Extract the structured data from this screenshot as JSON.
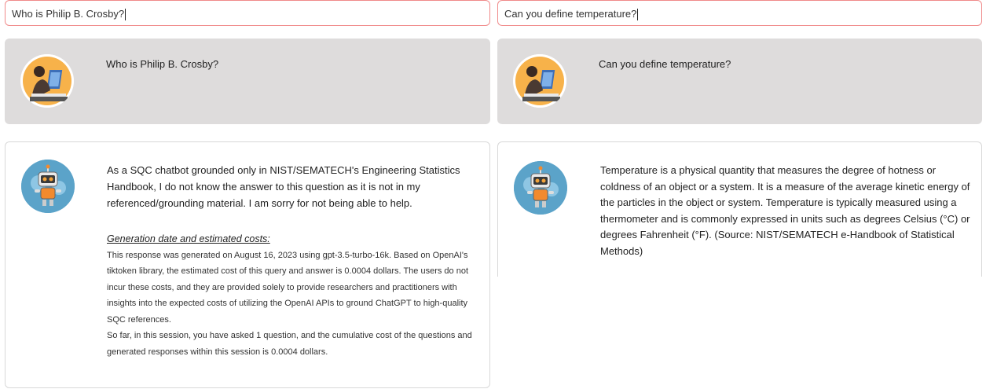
{
  "left": {
    "input_value": "Who is Philip B. Crosby?",
    "user_message": "Who is Philip B. Crosby?",
    "bot_answer": "As a SQC chatbot grounded only in NIST/SEMATECH's Engineering Statistics Handbook, I do not know the answer to this question as it is not in my referenced/grounding material. I am sorry for not being able to help.",
    "generation_title": "Generation date and estimated costs:",
    "generation_text": "This response was generated on August 16, 2023 using gpt-3.5-turbo-16k. Based on OpenAI's tiktoken library, the estimated cost of this query and answer is 0.0004 dollars. The users do not incur these costs, and they are provided solely to provide researchers and practitioners with insights into the expected costs of utilizing the OpenAI APIs to ground ChatGPT to high-quality SQC references.",
    "session_text": "So far, in this session, you have asked 1 question, and the cumulative cost of the questions and generated responses within this session is 0.0004 dollars."
  },
  "right": {
    "input_value": "Can you define temperature?",
    "user_message": "Can you define temperature?",
    "bot_answer": "Temperature is a physical quantity that measures the degree of hotness or coldness of an object or a system. It is a measure of the average kinetic energy of the particles in the object or system. Temperature is typically measured using a thermometer and is commonly expressed in units such as degrees Celsius (°C) or degrees Fahrenheit (°F). (Source: NIST/SEMATECH e-Handbook of Statistical Methods)"
  },
  "icons": {
    "user_avatar": "person-at-laptop-icon",
    "bot_avatar": "robot-icon"
  },
  "colors": {
    "input_border": "#f08a8a",
    "user_card_bg": "#dedcdc",
    "bot_avatar_bg": "#5ba3c9"
  }
}
